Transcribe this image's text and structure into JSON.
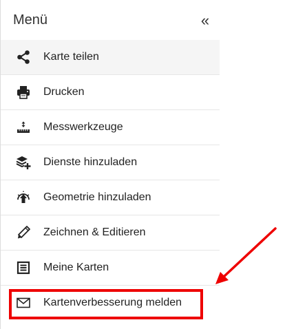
{
  "menu": {
    "title": "Menü",
    "collapse_glyph": "«",
    "items": [
      {
        "label": "Karte teilen",
        "icon": "share-icon"
      },
      {
        "label": "Drucken",
        "icon": "printer-icon"
      },
      {
        "label": "Messwerkzeuge",
        "icon": "measure-ruler-icon"
      },
      {
        "label": "Dienste hinzuladen",
        "icon": "layers-add-icon"
      },
      {
        "label": "Geometrie hinzuladen",
        "icon": "geometry-upload-icon"
      },
      {
        "label": "Zeichnen & Editieren",
        "icon": "pencil-icon"
      },
      {
        "label": "Meine Karten",
        "icon": "list-document-icon"
      },
      {
        "label": "Kartenverbesserung melden",
        "icon": "envelope-icon"
      }
    ]
  },
  "annotation": {
    "highlight_color": "#ee0000",
    "highlighted_item": "Kartenverbesserung melden"
  }
}
